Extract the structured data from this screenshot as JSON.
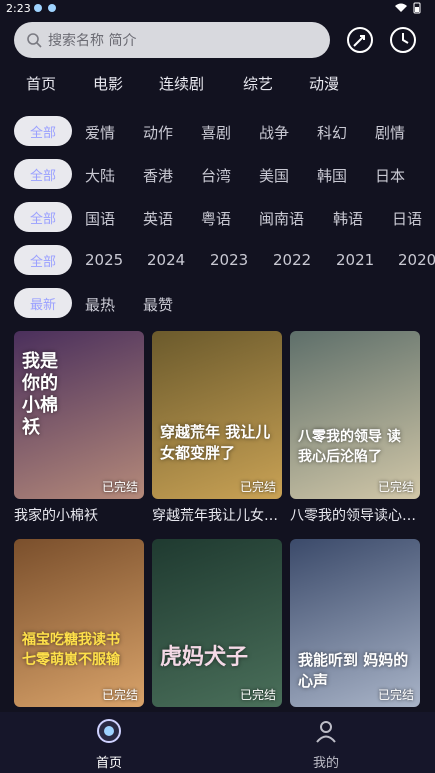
{
  "status": {
    "time": "2:23"
  },
  "search": {
    "placeholder": "搜索名称 简介"
  },
  "nav": [
    "首页",
    "电影",
    "连续剧",
    "综艺",
    "动漫"
  ],
  "filters": {
    "genre": {
      "selected": "全部",
      "options": [
        "爱情",
        "动作",
        "喜剧",
        "战争",
        "科幻",
        "剧情"
      ]
    },
    "region": {
      "selected": "全部",
      "options": [
        "大陆",
        "香港",
        "台湾",
        "美国",
        "韩国",
        "日本"
      ]
    },
    "language": {
      "selected": "全部",
      "options": [
        "国语",
        "英语",
        "粤语",
        "闽南语",
        "韩语",
        "日语"
      ]
    },
    "year": {
      "selected": "全部",
      "options": [
        "2025",
        "2024",
        "2023",
        "2022",
        "2021",
        "2020"
      ]
    },
    "sort": {
      "selected": "最新",
      "options": [
        "最热",
        "最赞"
      ]
    }
  },
  "cards": [
    {
      "title": "我家的小棉袄",
      "badge": "已完结",
      "art": "我是你的小棉袄",
      "colors": [
        "#4a2f5c",
        "#b58a7a"
      ]
    },
    {
      "title": "穿越荒年我让儿女都变胖了",
      "badge": "已完结",
      "art": "穿越荒年 我让儿女都变胖了",
      "colors": [
        "#6b5a2c",
        "#c9a255"
      ]
    },
    {
      "title": "八零我的领导读心后沦陷了",
      "badge": "已完结",
      "art": "八零我的领导 读我心后沦陷了",
      "colors": [
        "#5e6f6a",
        "#d1c7a8"
      ]
    },
    {
      "title": "福宝吃糖我读书七零萌崽不服输",
      "badge": "已完结",
      "art": "福宝吃糖我读书 七零萌崽不服输",
      "colors": [
        "#7a4f2c",
        "#d9a36a"
      ]
    },
    {
      "title": "虎妈犬子",
      "badge": "已完结",
      "art": "虎妈犬子",
      "colors": [
        "#1f3a30",
        "#4a6f5a"
      ]
    },
    {
      "title": "我能听到妈妈的心声",
      "badge": "已完结",
      "art": "我能听到 妈妈的心声",
      "colors": [
        "#3b4a6a",
        "#a9b4c8"
      ]
    }
  ],
  "tabs": {
    "home": "首页",
    "mine": "我的"
  }
}
